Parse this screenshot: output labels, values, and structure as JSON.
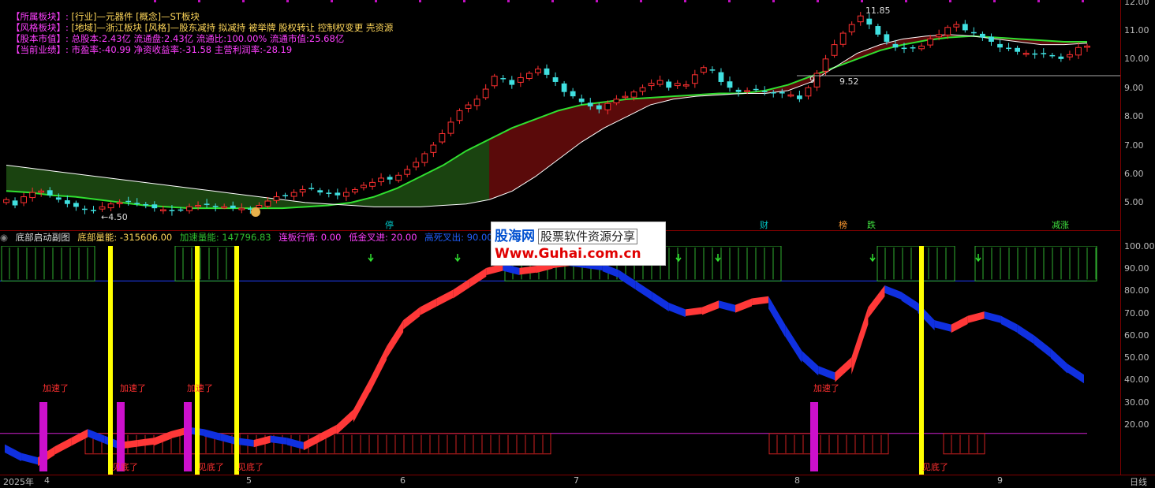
{
  "info_lines": [
    {
      "key": "【所属板块】:",
      "value": "[行业]—元器件 [概念]—ST板块"
    },
    {
      "key": "【风格板块】:",
      "value": "[地域]—浙江板块 [风格]—股东减持 拟减持 被举牌 股权转让 控制权变更 壳资源"
    },
    {
      "key": "【股本市值】:",
      "value": "总股本:2.43亿 流通盘:2.43亿 流通比:100.00% 流通市值:25.68亿"
    },
    {
      "key": "【当前业绩】:",
      "value": "市盈率:-40.99 净资收益率:-31.58 主营利润率:-28.19"
    }
  ],
  "price_axis": [
    "12.00",
    "11.00",
    "10.00",
    "9.00",
    "8.00",
    "7.00",
    "6.00",
    "5.00"
  ],
  "price_annotations": {
    "high": "11.85",
    "low": "4.50",
    "mid_a": "9",
    "mid_b": "9.52"
  },
  "event_markers": [
    {
      "text": "停",
      "color": "#00c8c8"
    },
    {
      "text": "财",
      "color": "#00c8c8"
    },
    {
      "text": "榜",
      "color": "#ff9a30"
    },
    {
      "text": "跌",
      "color": "#40e040"
    },
    {
      "text": "减涨",
      "color": "#40e040"
    }
  ],
  "sub_header": {
    "name": "底部启动副图",
    "fields": [
      {
        "label": "底部量能: -315606.00",
        "color": "#ffd75a"
      },
      {
        "label": "加速量能: 147796.83",
        "color": "#30c030"
      },
      {
        "label": "连板行情: 0.00",
        "color": "#ff40ff"
      },
      {
        "label": "低金叉进: 20.00",
        "color": "#ff40ff"
      },
      {
        "label": "高死叉出: 90.00",
        "color": "#2060ff"
      }
    ]
  },
  "sub_axis": [
    "100.00",
    "90.00",
    "80.00",
    "70.00",
    "60.00",
    "50.00",
    "40.00",
    "30.00",
    "20.00"
  ],
  "signal_labels": {
    "accelerate": "加速了",
    "bottom": "见底了"
  },
  "date_axis": [
    "2025年",
    "4",
    "5",
    "6",
    "7",
    "8",
    "9"
  ],
  "period_label": "日线",
  "watermark": {
    "logo": "股海网",
    "tagline": "股票软件资源分享",
    "url": "Www.Guhai.com.cn"
  },
  "colors": {
    "up": "#ff3030",
    "down": "#40e0e0",
    "ma_long": "#30e030",
    "ma_short": "#ffffff",
    "rise_fill": "#ff3838",
    "fall_fill": "#1030e0",
    "signal_bar": "#ffff00",
    "magenta_bar": "#cc10cc"
  },
  "chart_data": [
    {
      "type": "candlestick",
      "title": "",
      "ylim": [
        4.3,
        12.1
      ],
      "annotations": [
        {
          "label": "11.85",
          "value": 11.85
        },
        {
          "label": "4.50",
          "value": 4.5
        },
        {
          "label": "9.52",
          "value": 9.52
        }
      ],
      "series": [
        {
          "name": "",
          "values": [
            5.2,
            5.0,
            5.3,
            5.45,
            5.5,
            5.35,
            5.2,
            5.05,
            4.95,
            4.85,
            4.8,
            4.95,
            5.05,
            5.1,
            5.15,
            5.05,
            5.0,
            4.9,
            4.85,
            4.8,
            4.85,
            4.95,
            5.0,
            5.05,
            4.95,
            4.95,
            4.9,
            4.9,
            4.85,
            5.0,
            5.15,
            5.3,
            5.35,
            5.45,
            5.55,
            5.6,
            5.45,
            5.4,
            5.35,
            5.45,
            5.55,
            5.7,
            5.8,
            5.95,
            5.9,
            6.05,
            6.25,
            6.5,
            6.8,
            7.1,
            7.5,
            7.9,
            8.3,
            8.5,
            8.7,
            9.05,
            9.5,
            9.4,
            9.2,
            9.45,
            9.6,
            9.75,
            9.55,
            9.3,
            8.95,
            8.8,
            8.6,
            8.45,
            8.35,
            8.55,
            8.7,
            8.8,
            8.95,
            9.1,
            9.25,
            9.35,
            9.1,
            9.25,
            9.2,
            9.55,
            9.8,
            9.7,
            9.3,
            9.1,
            8.95,
            9.0,
            9.05,
            8.95,
            8.9,
            8.9,
            8.85,
            8.7,
            9.1,
            9.6,
            10.1,
            10.6,
            11.0,
            11.3,
            11.6,
            11.3,
            10.95,
            10.7,
            10.5,
            10.45,
            10.5,
            10.55,
            10.8,
            10.95,
            11.2,
            11.3,
            11.1,
            11.0,
            10.85,
            10.7,
            10.5,
            10.45,
            10.35,
            10.3,
            10.25,
            10.3,
            10.2,
            10.1,
            10.25,
            10.5,
            10.55
          ]
        },
        {
          "name": "",
          "type": "line",
          "values": [
            6.4,
            6.3,
            6.2,
            6.1,
            6.0,
            5.9,
            5.8,
            5.7,
            5.6,
            5.5,
            5.4,
            5.3,
            5.2,
            5.1,
            5.05,
            5.0,
            4.95,
            4.95,
            4.95,
            5.0,
            5.05,
            5.2,
            5.5,
            6.0,
            6.6,
            7.2,
            7.7,
            8.1,
            8.5,
            8.7,
            8.8,
            8.85,
            8.9,
            8.9,
            9.0,
            9.3,
            9.8,
            10.3,
            10.6,
            10.8,
            10.9,
            10.95,
            10.9,
            10.8,
            10.7,
            10.6,
            10.6,
            10.65
          ]
        },
        {
          "name": "",
          "type": "line",
          "values": [
            5.5,
            5.45,
            5.35,
            5.3,
            5.2,
            5.1,
            5.0,
            4.95,
            4.9,
            4.9,
            4.9,
            4.9,
            4.9,
            4.95,
            5.0,
            5.1,
            5.3,
            5.6,
            6.0,
            6.4,
            6.9,
            7.3,
            7.7,
            8.0,
            8.3,
            8.5,
            8.6,
            8.7,
            8.75,
            8.8,
            8.85,
            8.9,
            8.9,
            9.0,
            9.2,
            9.5,
            9.8,
            10.1,
            10.4,
            10.6,
            10.75,
            10.85,
            10.9,
            10.85,
            10.8,
            10.75,
            10.7,
            10.7
          ]
        }
      ]
    },
    {
      "type": "area",
      "title": "",
      "ylim": [
        0,
        105
      ],
      "series": [
        {
          "name": "",
          "values": [
            15,
            11,
            9,
            14,
            18,
            22,
            19,
            16,
            17,
            18,
            21,
            23,
            22,
            20,
            18,
            17,
            19,
            18,
            16,
            20,
            24,
            31,
            45,
            60,
            72,
            78,
            82,
            86,
            91,
            96,
            98,
            96,
            97,
            99,
            100,
            99,
            98,
            95,
            90,
            85,
            80,
            77,
            78,
            81,
            79,
            82,
            83,
            70,
            58,
            51,
            48,
            55,
            78,
            88,
            85,
            80,
            72,
            70,
            74,
            76,
            74,
            70,
            65,
            59,
            52,
            47
          ]
        }
      ]
    }
  ]
}
